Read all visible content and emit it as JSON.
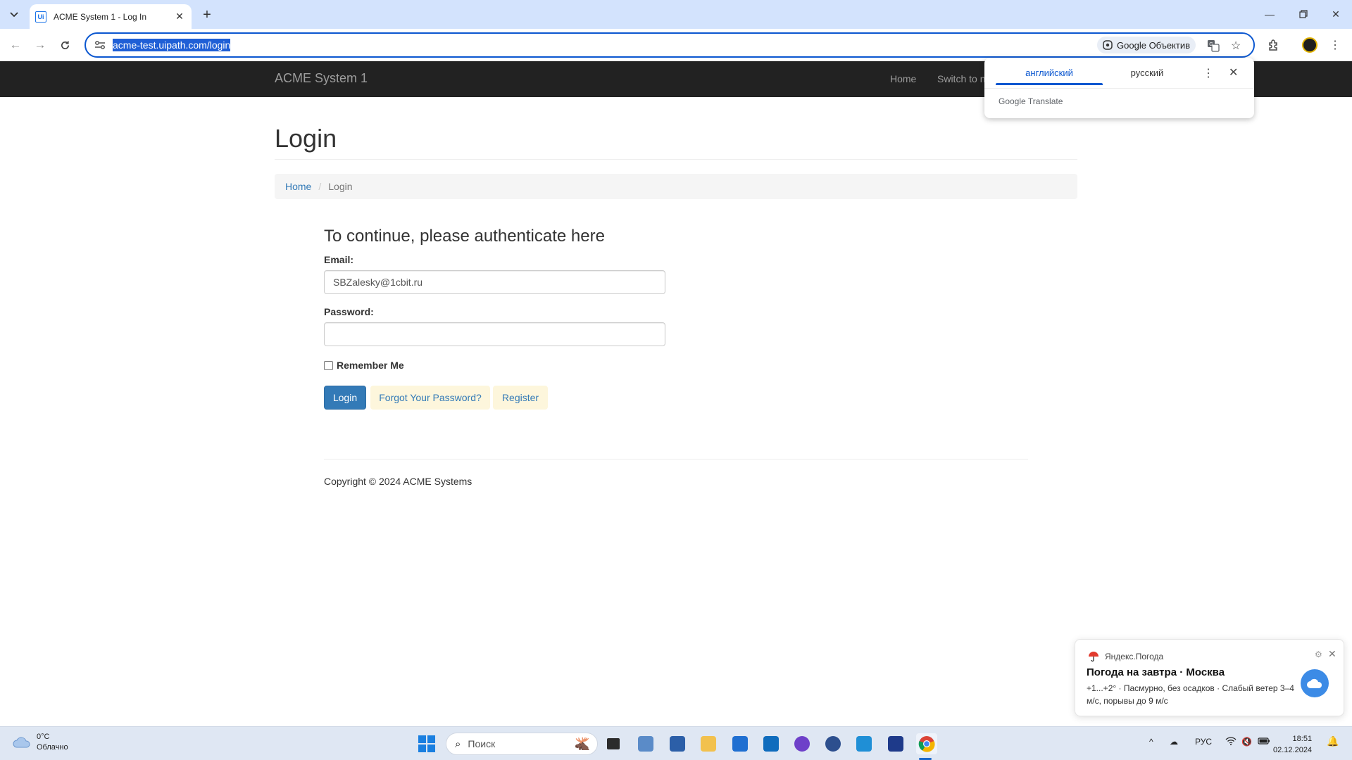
{
  "browser": {
    "tab_title": "ACME System 1 - Log In",
    "url": "acme-test.uipath.com/login",
    "lens_label": "Google Объектив"
  },
  "translate_popup": {
    "source_lang": "английский",
    "target_lang": "русский",
    "brand_google": "Google",
    "brand_translate": "Translate"
  },
  "site_nav": {
    "brand": "ACME System 1",
    "home": "Home",
    "switch": "Switch to n"
  },
  "page": {
    "title": "Login",
    "breadcrumb": {
      "home": "Home",
      "current": "Login"
    },
    "form_heading": "To continue, please authenticate here",
    "email_label": "Email:",
    "email_value": "SBZalesky@1cbit.ru",
    "password_label": "Password:",
    "password_value": "",
    "remember_label": "Remember Me",
    "login_button": "Login",
    "forgot_link": "Forgot Your Password?",
    "register_link": "Register",
    "copyright": "Copyright © 2024 ACME Systems"
  },
  "notification": {
    "app_name": "Яндекс.Погода",
    "title": "Погода на завтра · Москва",
    "body": "+1...+2° · Пасмурно, без осадков · Слабый ветер 3–4 м/с, порывы до 9 м/с"
  },
  "taskbar": {
    "weather_temp": "0°C",
    "weather_desc": "Облачно",
    "search_placeholder": "Поиск",
    "language": "РУС",
    "time": "18:51",
    "date": "02.12.2024"
  },
  "colors": {
    "omnibox_focus": "#0b57d0",
    "navbar_bg": "#222222",
    "primary_button": "#337ab7",
    "link": "#337ab7",
    "link_button_bg": "#fdf6dc"
  }
}
